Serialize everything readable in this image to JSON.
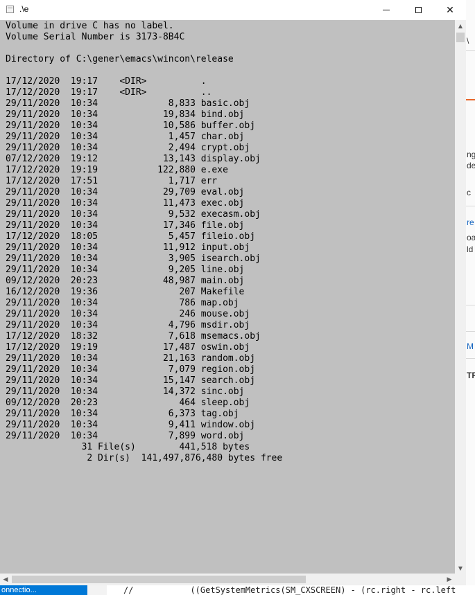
{
  "window": {
    "title": ".\\e",
    "minimize_label": "minimize",
    "maximize_label": "maximize",
    "close_glyph": "✕"
  },
  "console": {
    "lines": [
      "Volume in drive C has no label.",
      "Volume Serial Number is 3173-8B4C",
      "",
      "Directory of C:\\gener\\emacs\\wincon\\release",
      "",
      "17/12/2020  19:17    <DIR>          .",
      "17/12/2020  19:17    <DIR>          ..",
      "29/11/2020  10:34             8,833 basic.obj",
      "29/11/2020  10:34            19,834 bind.obj",
      "29/11/2020  10:34            10,586 buffer.obj",
      "29/11/2020  10:34             1,457 char.obj",
      "29/11/2020  10:34             2,494 crypt.obj",
      "07/12/2020  19:12            13,143 display.obj",
      "17/12/2020  19:19           122,880 e.exe",
      "17/12/2020  17:51             1,717 err",
      "29/11/2020  10:34            29,709 eval.obj",
      "29/11/2020  10:34            11,473 exec.obj",
      "29/11/2020  10:34             9,532 execasm.obj",
      "29/11/2020  10:34            17,346 file.obj",
      "17/12/2020  18:05             5,457 fileio.obj",
      "29/11/2020  10:34            11,912 input.obj",
      "29/11/2020  10:34             3,905 isearch.obj",
      "29/11/2020  10:34             9,205 line.obj",
      "09/12/2020  20:23            48,987 main.obj",
      "16/12/2020  19:36               207 Makefile",
      "29/11/2020  10:34               786 map.obj",
      "29/11/2020  10:34               246 mouse.obj",
      "29/11/2020  10:34             4,796 msdir.obj",
      "17/12/2020  18:32             7,618 msemacs.obj",
      "17/12/2020  19:19            17,487 oswin.obj",
      "29/11/2020  10:34            21,163 random.obj",
      "29/11/2020  10:34             7,079 region.obj",
      "29/11/2020  10:34            15,147 search.obj",
      "29/11/2020  10:34            14,372 sinc.obj",
      "09/12/2020  20:23               464 sleep.obj",
      "29/11/2020  10:34             6,373 tag.obj",
      "29/11/2020  10:34             9,411 window.obj",
      "29/11/2020  10:34             7,899 word.obj",
      "              31 File(s)        441,518 bytes",
      "               2 Dir(s)  141,497,876,480 bytes free"
    ]
  },
  "background_right": {
    "fragments": [
      "\\",
      "ng",
      "de",
      "c",
      "re",
      "oa",
      "ld",
      "M",
      "TR"
    ]
  },
  "bottom": {
    "status_text": "onnectio...",
    "code_comment": "//",
    "code_text": "((GetSystemMetrics(SM_CXSCREEN) - (rc.right - rc.left"
  },
  "scrollbars": {
    "up_arrow": "▲",
    "down_arrow": "▼",
    "left_arrow": "◀",
    "right_arrow": "▶"
  }
}
